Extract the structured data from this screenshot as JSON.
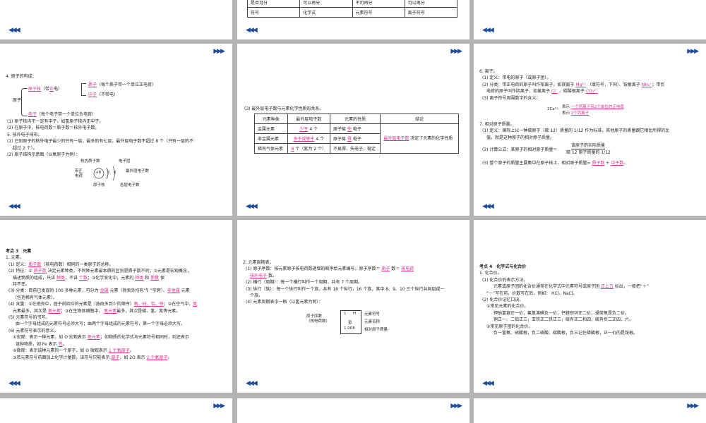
{
  "top_table": [
    [
      "是否可分",
      "可以再分",
      "不可再分",
      "可以再分"
    ],
    [
      "符号",
      "化学式",
      "元素符号",
      "离子符号"
    ]
  ],
  "nav": {
    "prev": "◀◀◀",
    "next": "▶▶▶"
  },
  "s4": {
    "title": "4. 原子的构成：",
    "atom": "原子",
    "nucleus": "原子核",
    "nucleus_charge_pre": "（带",
    "nucleus_charge": "正",
    "nucleus_charge_post": "电）",
    "proton": "质子",
    "proton_note": "（每个质子带一个单位正电荷）",
    "neutron": "中子",
    "neutron_note": "（不带电）",
    "electron": "电子",
    "electron_note": "（每个电子带一个单位负电荷）",
    "n1": "(1) 原子核内不一定有中子，如氢原子核内无中子。",
    "n2": "(2) 在原子中，核电荷数＝质子数＝核外电子数。",
    "t5": "5. 核外电子排布。",
    "p1a": "(1) 已知原子的核外电子最少的只有一层，最多的有七层，最外层电子数不超过 8 个（只有一层的不",
    "p1b": "超过 2 个）。",
    "p2": "(2) 原子结构示意图（以氧原子为例）：",
    "diag_proton": "核内质子数",
    "diag_layer": "电子层",
    "diag_charge": "带正",
    "diag_charge2": "电荷",
    "diag_outer": "最外层电子数",
    "diag_nucleus": "原子核",
    "diag_each": "各层电子数",
    "nucleus_label": "+8",
    "e1": "2",
    "e2": "6"
  },
  "s5": {
    "title": "(3) 最外层电子数与元素化学性质的关系。",
    "headers": [
      "元素种类",
      "最外层电子数",
      "元素的性质",
      "结论"
    ],
    "rows": [
      {
        "kind": "金属元素",
        "outer_ans": "少于",
        "outer_post": "4 个",
        "prop_pre": "原子易",
        "prop_ans": "失",
        "prop_post": "电子"
      },
      {
        "kind": "非金属元素",
        "outer_ans": "多于或等于",
        "outer_post": "4 个",
        "prop_pre": "原子易",
        "prop_ans": "得",
        "prop_post": "电子"
      },
      {
        "kind": "稀有气体元素",
        "outer_ans": "8",
        "outer_post": "个（氦为 2 个）",
        "prop_pre": "不易得、失电子，稳定",
        "prop_ans": "",
        "prop_post": ""
      }
    ],
    "concl_ans": "最外层电子数",
    "concl_post": "决定了元素的化学性质"
  },
  "s6": {
    "t6": "6. 离子。",
    "d1": "(1) 定义：带电的原子（或原子团）。",
    "d2a": "(2) 分类：带正电荷的原子叫作阳离子，如镁离子",
    "mg": "Mg²⁺",
    "d2b": "（填符号，下同）、铵根离子",
    "nh4": "NH₄⁺",
    "d2c": "；带负",
    "d2d": "电荷的原子叫作阴离子，如氯离子",
    "cl": "Cl⁻",
    "d2e": "、碳酸根离子",
    "co3": "CO₃²⁻",
    "d3": "(3) 离子符号周围数字的含义：",
    "ion": "2Ca²⁺",
    "ion_m1_pre": "表示",
    "ion_m1": "一个钙离子带2个单位的正电荷",
    "ion_m2_pre": "表示",
    "ion_m2": "2个钙离子",
    "t7": "7. 相对原子质量。",
    "r1a": "(1) 定义：国际上以一种碳原子（碳 12）质量的 1/12 作为标准，其他原子的质量跟它相比所得的比",
    "r1b": "值，就是这种原子的相对原子质量。",
    "r2pre": "(2) 计算公式：某原子的相对原子质量＝",
    "r2num": "该原子的实际质量",
    "r2den": "碳 12 原子质量的 1/12",
    "r3pre": "(3) 整个原子的质量主要集中在原子核上，相对原子质量≈",
    "r3a": "质子数",
    "r3mid": "+",
    "r3b": "中子数",
    "r3end": "。"
  },
  "s7": {
    "title": "考点 3　元素",
    "t1": "1. 元素。",
    "l1a": "(1) 定义：",
    "l1ans": "质子数",
    "l1b": "（核电荷数）相同的一类原子的总称。",
    "l2a": "(2) 特征：①",
    "l2ans1": "质子数",
    "l2b": "决定元素种类，不同种元素最本质的区别是质子数不同；②元素是宏观概念，",
    "l2c": "描述物质的组成，只讲",
    "l2ans2": "种类",
    "l2d": "，不讲",
    "l2ans3": "个数",
    "l2e": "；③化学变化中，元素的",
    "l2ans4": "种类",
    "l2f": "和",
    "l2ans5": "质量",
    "l2g": "保",
    "l2h": "持不变。",
    "l3a": "(3) 分类：目前已发现的 100 多种元素，可分为",
    "l3ans1": "金属",
    "l3b": "元素（除汞外均有“钅”字旁）、",
    "l3ans2": "非金属",
    "l3c": "元素",
    "l3d": "（包括稀有气体元素）。",
    "l4a": "(4) 含量：①在地壳中，居于前四位的元素是（按由多到少的顺序）",
    "l4ans1": "氧、硅、铝、铁",
    "l4b": "；②在空气中，",
    "l4ans2": "氮",
    "l4c": "元素",
    "l4ans3": "最多，其次是",
    "l4ans4": "氧元素",
    "l4d": "；③在生物体细胞中，",
    "l4ans5": "氧元素",
    "l4e": "最多，其次是碳、氢、氮等元素。",
    "l5": "(5) 元素符号的书写。",
    "l5b": "由一个字母组成的元素符号必须大写；由两个字母组成的元素符号，第一个字母必须大写。",
    "l6": "(6) 元素符号表示的意义。",
    "l6a": "①宏观：表示一种元素，如 O 宏观表示",
    "l6ans1": "氧元素",
    "l6b": "；如物质的化学式与元素符号相同时，则还表示",
    "l6c": "该种物质，如 Fe 表示",
    "l6ans2": "铁",
    "l6d": "。",
    "l6e": "②微观：表示该种元素的一个原子，如 O 微观表示",
    "l6ans3": "1 个氧原子",
    "l6f": "。",
    "l6g": "③若元素符号前面加上化学计量数，该符号只能表示",
    "l6ans4": "原子",
    "l6h": "，如 2O 表示",
    "l6ans5": "2 个氧原子",
    "l6i": "。"
  },
  "s8": {
    "t2": "2. 元素周期表。",
    "a1pre": "(1) 原子序数：按元素原子核电荷数递增的顺序给元素编号。原子序数＝",
    "a1ans1": "质子",
    "a1mid": "数＝",
    "a1ans2": "核电荷",
    "a1end": "",
    "a1b_ans": "核外电子",
    "a1b_end": "数。",
    "a2": "(2) 横行（周期）：每一个横行叫作一个周期，共有 7 个周期。",
    "a3a": "(3) 纵行（族）：每一个纵行叫作一个族，共有 18 个纵行，16 个族，其中 8、9、10 三个纵行共同组成一",
    "a3b": "个族。",
    "a4": "(4) 元素周期表中一格（以氢元素为例）：",
    "cell_left1": "原子序数",
    "cell_left2": "（核电荷数）",
    "cell_num": "1",
    "cell_sym": "H",
    "cell_name": "氢",
    "cell_mass": "1.008",
    "cell_r1": "元素符号",
    "cell_r2": "元素名称",
    "cell_r3": "相对原子质量"
  },
  "s9": {
    "title": "考点 4　化学式与化合价",
    "t1": "1. 化合价。",
    "b1": "(1) 化合价的表示方法。",
    "b1a": "元素或原子团的化合价通常在化学式中元素符号或原子团",
    "b1ans": "正上方",
    "b1b": "标出，一般把“＋”",
    "b1c": "“－”写在前，价数写在后，例如：",
    "b1d": "HCl、NaCl。",
    "b2": "(2) 化合价记忆口诀。",
    "b2a": "①常见元素的化合价。",
    "b2b": "钾钠氢银正一价，氟氯溴碘负一价，钙镁钡锌正二价，通常氧是负二价。",
    "b2c": "铜正一、二铝正三，亚铁正二铁正三，硫有正二和四，硫有负二正四、六。",
    "b2d": "②常见原子团的化合价。",
    "b2e": "负一氢氧、硝酸根，负二硫酸、碳酸根，负三记住磷酸根，正一价的是铵根。"
  }
}
